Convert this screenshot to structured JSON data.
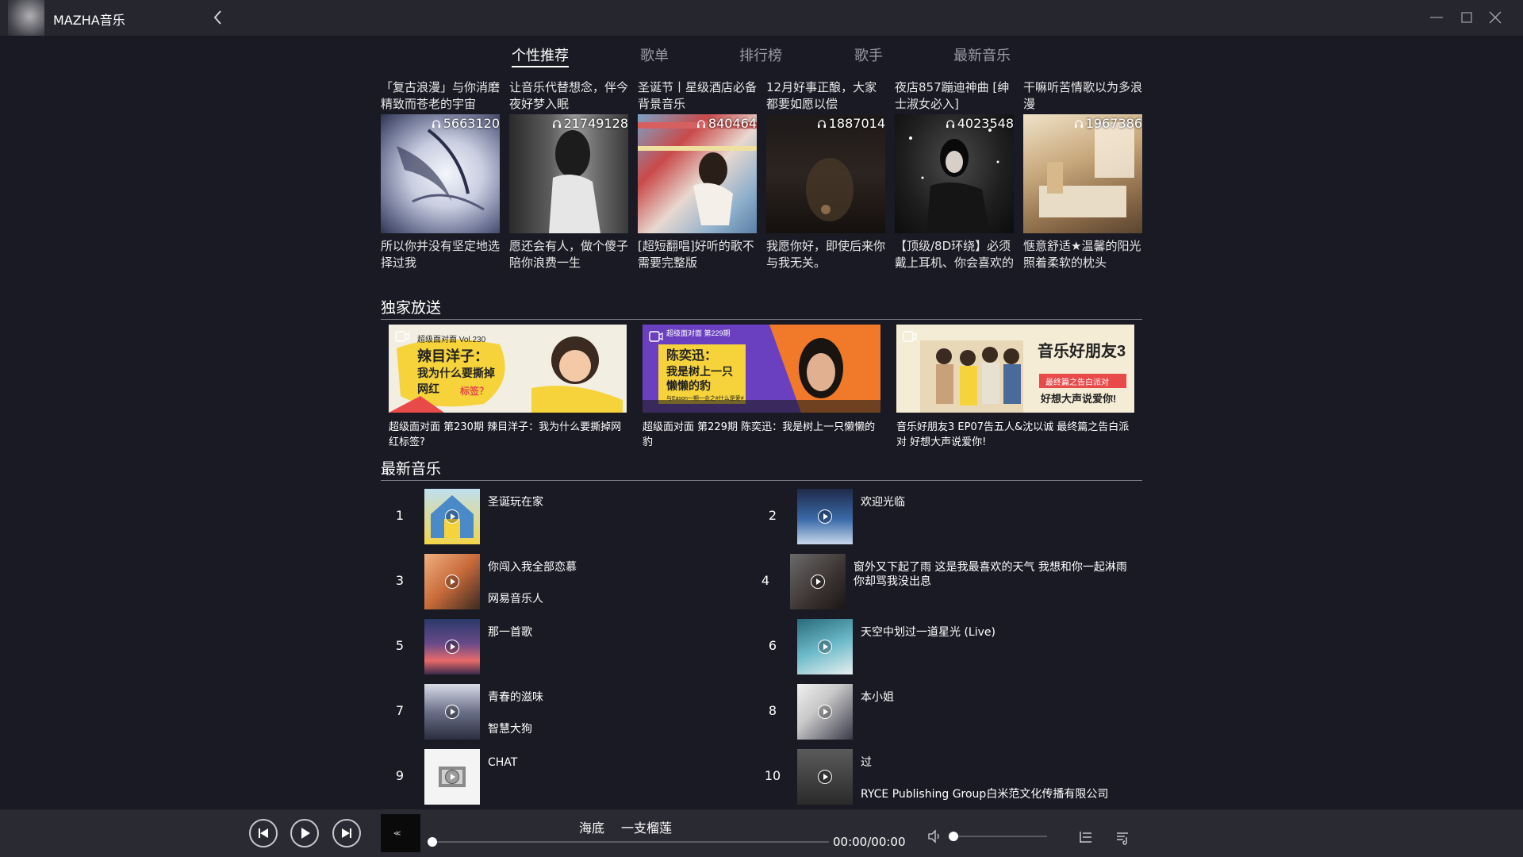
{
  "app": {
    "title": "MAZHA音乐"
  },
  "tabs": [
    {
      "label": "个性推荐",
      "active": true
    },
    {
      "label": "歌单",
      "active": false
    },
    {
      "label": "排行榜",
      "active": false
    },
    {
      "label": "歌手",
      "active": false
    },
    {
      "label": "最新音乐",
      "active": false
    }
  ],
  "playlists": [
    {
      "top_label": "「复古浪漫」与你消磨精致而苍老的宇宙",
      "count": "5663120",
      "bottom_label": "所以你并没有坚定地选择过我"
    },
    {
      "top_label": "让音乐代替想念，伴今夜好梦入眠",
      "count": "21749128",
      "bottom_label": "愿还会有人，做个傻子陪你浪费一生"
    },
    {
      "top_label": "圣诞节丨星级酒店必备背景音乐",
      "count": "840464",
      "bottom_label": "[超短翻唱]好听的歌不需要完整版"
    },
    {
      "top_label": "12月好事正酿，大家都要如愿以偿",
      "count": "1887014",
      "bottom_label": "我愿你好，即使后来你与我无关。"
    },
    {
      "top_label": "夜店857蹦迪神曲 [绅士淑女必入]",
      "count": "4023548",
      "bottom_label": "【顶级/8D环绕】必须戴上耳机、你会喜欢的"
    },
    {
      "top_label": "干嘛听苦情歌以为多浪漫",
      "count": "1967386",
      "bottom_label": "惬意舒适★温馨的阳光照着柔软的枕头"
    }
  ],
  "exclusive": {
    "title": "独家放送",
    "items": [
      {
        "label": "超级面对面 第230期 辣目洋子：我为什么要撕掉网红标签?",
        "cover_text_1": "超级面对面 Vol.230",
        "cover_text_2": "辣目洋子：",
        "cover_text_3": "我为什么要撕掉",
        "cover_text_4": "网红",
        "cover_text_5": "标签？"
      },
      {
        "label": "超级面对面 第229期 陈奕迅：我是树上一只懒懒的豹",
        "cover_text_1": "超级面对面 第229期",
        "cover_text_2": "陈奕迅：",
        "cover_text_3": "我是树上一只",
        "cover_text_4": "懒懒的豹",
        "cover_text_5": "与Eason一期一会之#什么是爱#"
      },
      {
        "label": "音乐好朋友3 EP07告五人&沈以诚 最终篇之告白派对 好想大声说爱你!",
        "cover_text_1": "音乐好朋友3",
        "cover_text_2": "最终篇之告白派对",
        "cover_text_3": "好想大声说爱你!"
      }
    ]
  },
  "new_music": {
    "title": "最新音乐",
    "songs": [
      {
        "index": "1",
        "title": "圣诞玩在家",
        "artist": ""
      },
      {
        "index": "2",
        "title": "欢迎光临",
        "artist": ""
      },
      {
        "index": "3",
        "title": "你闯入我全部恋慕",
        "artist": "网易音乐人"
      },
      {
        "index": "4",
        "title": "窗外又下起了雨 这是我最喜欢的天气 我想和你一起淋雨 你却骂我没出息",
        "artist": ""
      },
      {
        "index": "5",
        "title": "那一首歌",
        "artist": ""
      },
      {
        "index": "6",
        "title": "天空中划过一道星光 (Live)",
        "artist": ""
      },
      {
        "index": "7",
        "title": "青春的滋味",
        "artist": "智慧大狗"
      },
      {
        "index": "8",
        "title": "本小姐",
        "artist": ""
      },
      {
        "index": "9",
        "title": "CHAT",
        "artist": ""
      },
      {
        "index": "10",
        "title": "过",
        "artist": "RYCE Publishing Group白米范文化传播有限公司"
      }
    ]
  },
  "player": {
    "title": "海底",
    "artist": "一支榴莲",
    "time": "00:00/00:00",
    "progress": 0,
    "volume": 0
  },
  "colors": {
    "background": "#1a1a24",
    "titlebar": "#26262f",
    "player_bar": "#2a2a32",
    "text": "#e8e8e8"
  }
}
